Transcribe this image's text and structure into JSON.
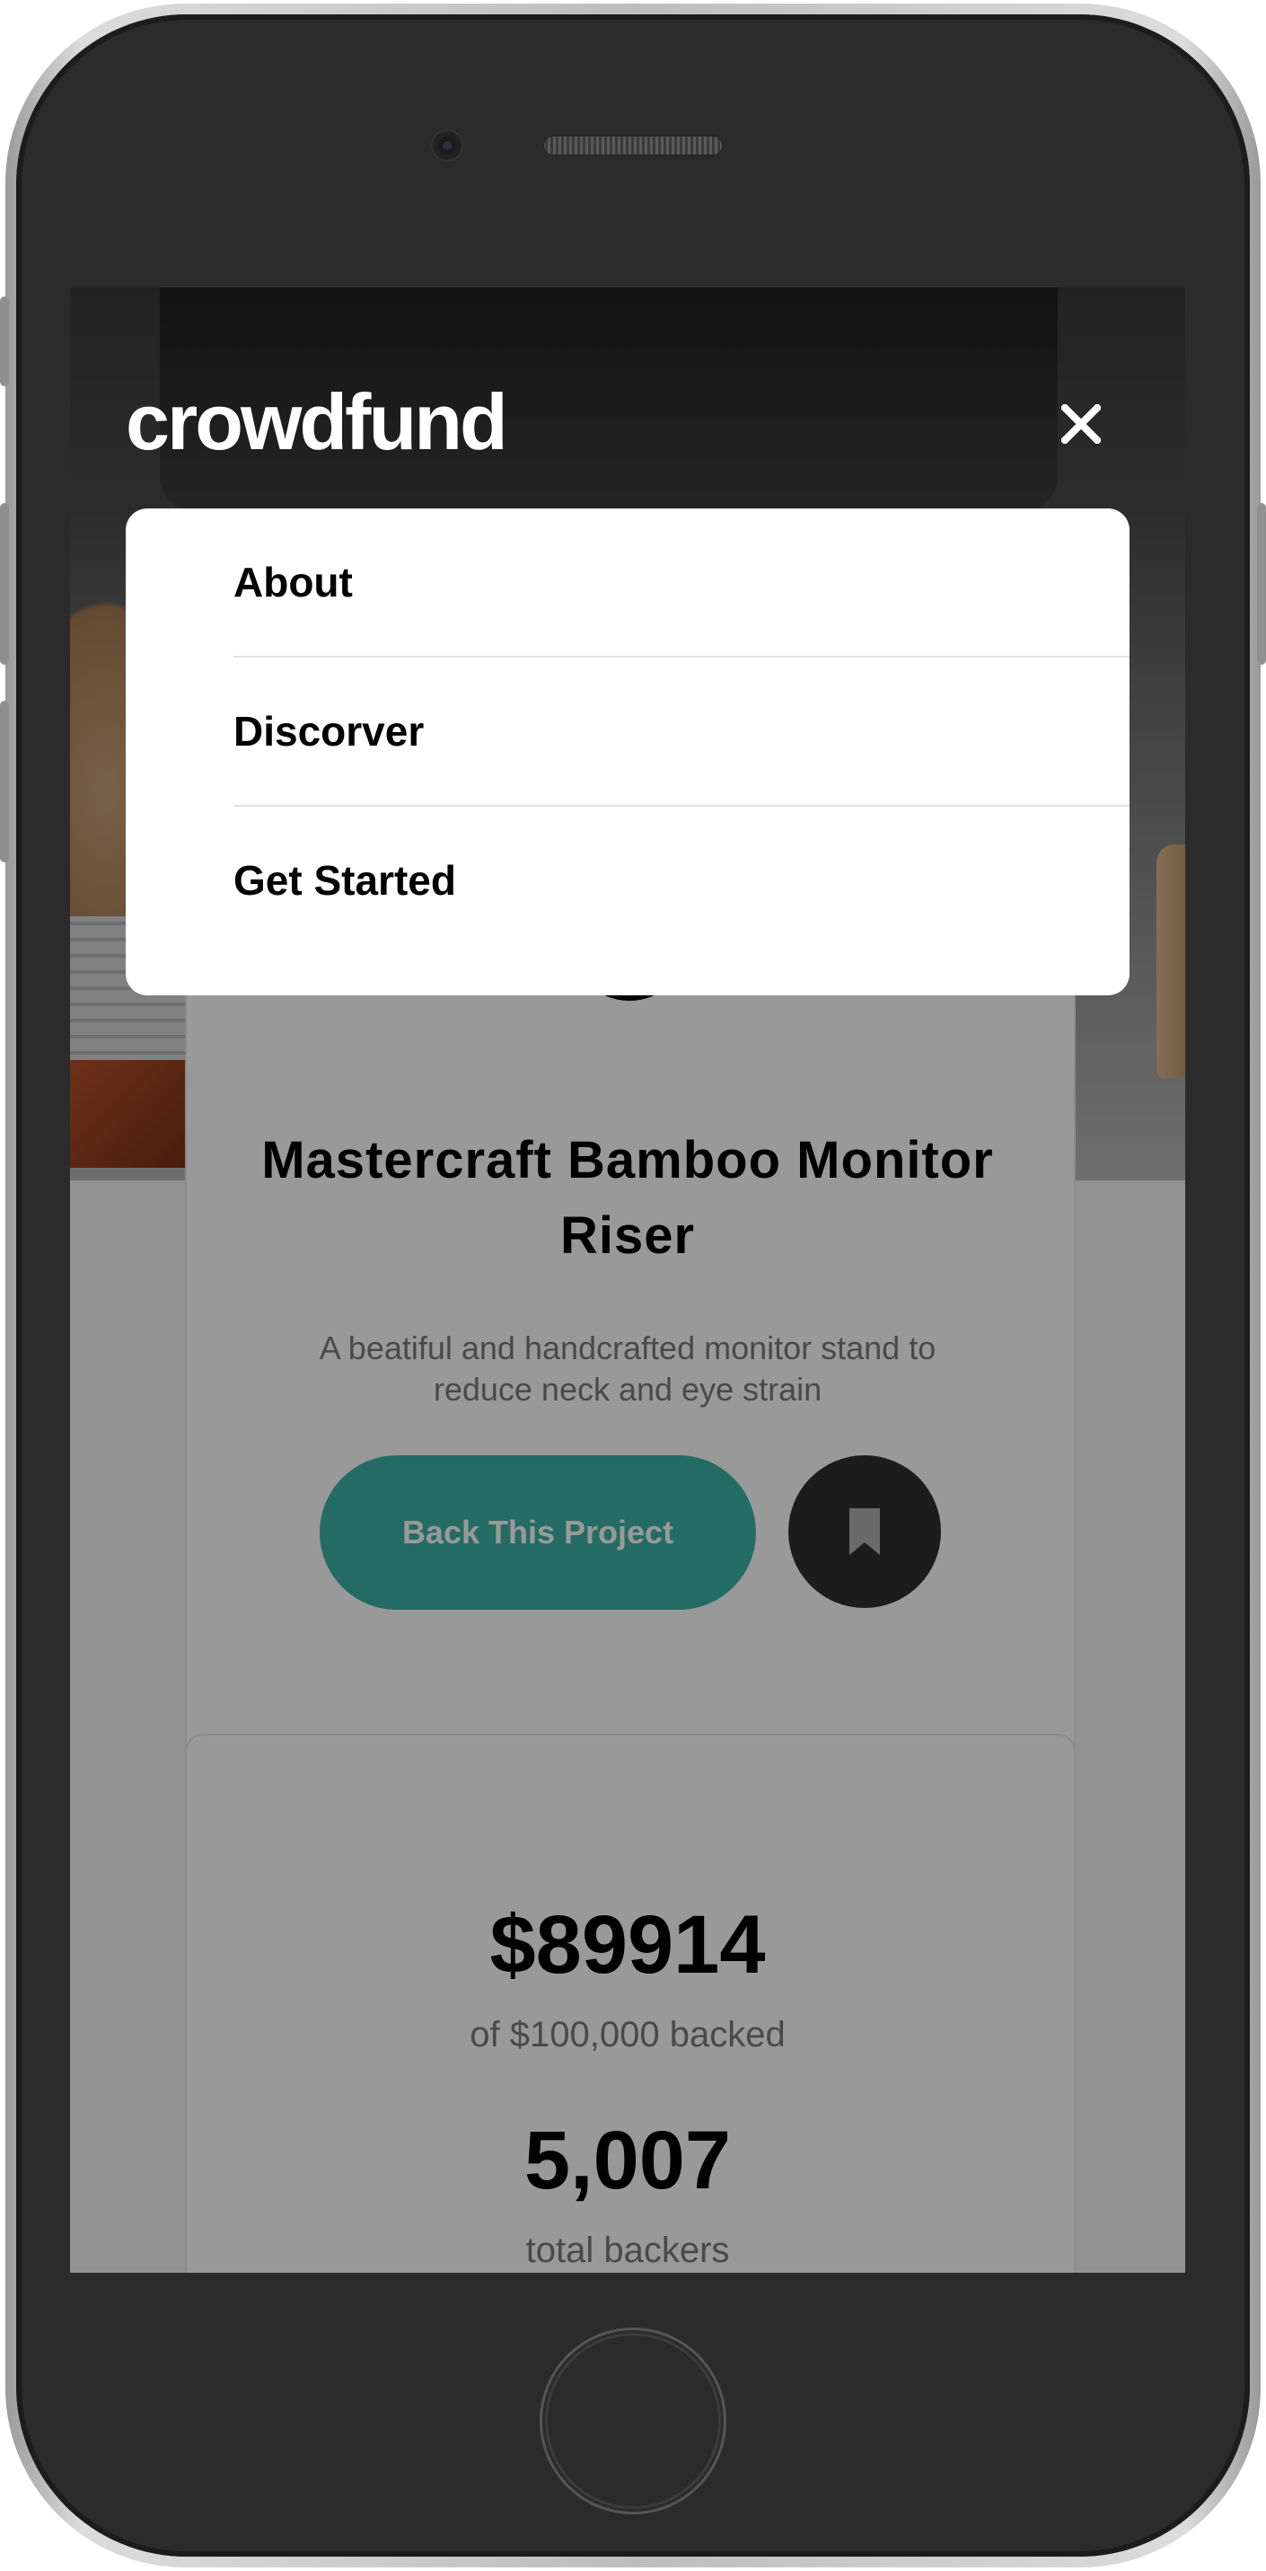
{
  "app": {
    "brand": "crowdfund"
  },
  "nav_menu": {
    "items": [
      {
        "label": "About"
      },
      {
        "label": "Discorver"
      },
      {
        "label": "Get Started"
      }
    ],
    "close_icon": "close-icon"
  },
  "project": {
    "title": "Mastercraft Bamboo Monitor Riser",
    "description": "A beatiful and handcrafted monitor stand to reduce neck and eye strain",
    "back_button_label": "Back This Project",
    "bookmark_icon": "bookmark-icon"
  },
  "stats": {
    "amount_backed": "$89914",
    "amount_backed_label": "of $100,000 backed",
    "total_backers": "5,007",
    "total_backers_label": "total backers"
  },
  "colors": {
    "accent": "#3cb4a6",
    "overlay": "rgba(0,0,0,0.4)",
    "phone_body": "#2b2b2b"
  }
}
